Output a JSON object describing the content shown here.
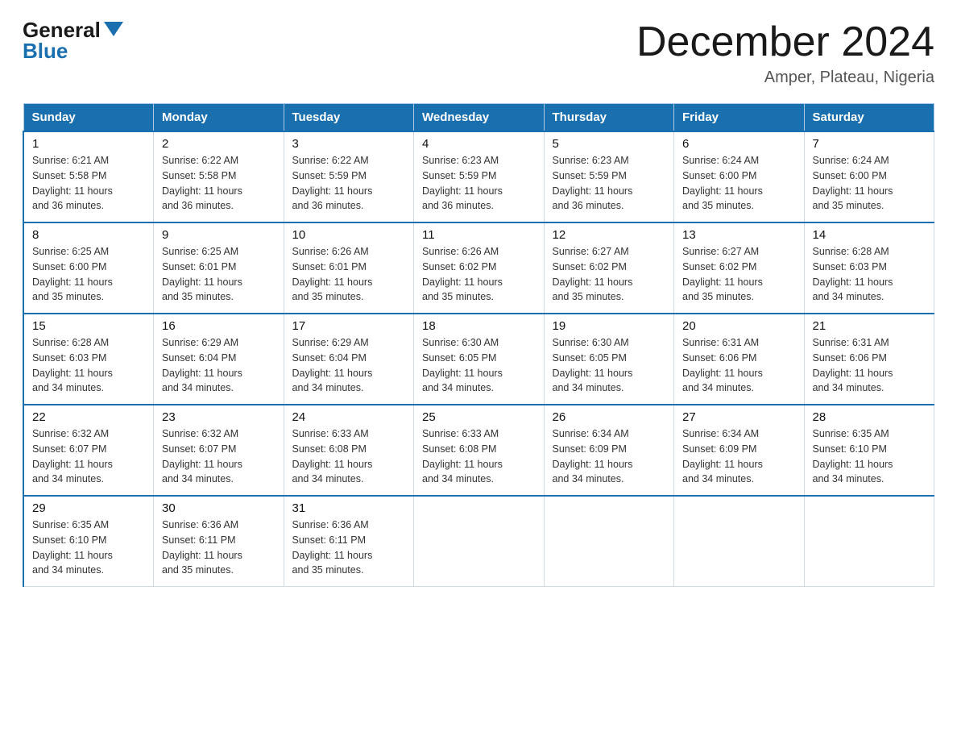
{
  "logo": {
    "general": "General",
    "blue": "Blue"
  },
  "title": "December 2024",
  "location": "Amper, Plateau, Nigeria",
  "days_of_week": [
    "Sunday",
    "Monday",
    "Tuesday",
    "Wednesday",
    "Thursday",
    "Friday",
    "Saturday"
  ],
  "weeks": [
    [
      {
        "day": "1",
        "sunrise": "6:21 AM",
        "sunset": "5:58 PM",
        "daylight": "11 hours and 36 minutes."
      },
      {
        "day": "2",
        "sunrise": "6:22 AM",
        "sunset": "5:58 PM",
        "daylight": "11 hours and 36 minutes."
      },
      {
        "day": "3",
        "sunrise": "6:22 AM",
        "sunset": "5:59 PM",
        "daylight": "11 hours and 36 minutes."
      },
      {
        "day": "4",
        "sunrise": "6:23 AM",
        "sunset": "5:59 PM",
        "daylight": "11 hours and 36 minutes."
      },
      {
        "day": "5",
        "sunrise": "6:23 AM",
        "sunset": "5:59 PM",
        "daylight": "11 hours and 36 minutes."
      },
      {
        "day": "6",
        "sunrise": "6:24 AM",
        "sunset": "6:00 PM",
        "daylight": "11 hours and 35 minutes."
      },
      {
        "day": "7",
        "sunrise": "6:24 AM",
        "sunset": "6:00 PM",
        "daylight": "11 hours and 35 minutes."
      }
    ],
    [
      {
        "day": "8",
        "sunrise": "6:25 AM",
        "sunset": "6:00 PM",
        "daylight": "11 hours and 35 minutes."
      },
      {
        "day": "9",
        "sunrise": "6:25 AM",
        "sunset": "6:01 PM",
        "daylight": "11 hours and 35 minutes."
      },
      {
        "day": "10",
        "sunrise": "6:26 AM",
        "sunset": "6:01 PM",
        "daylight": "11 hours and 35 minutes."
      },
      {
        "day": "11",
        "sunrise": "6:26 AM",
        "sunset": "6:02 PM",
        "daylight": "11 hours and 35 minutes."
      },
      {
        "day": "12",
        "sunrise": "6:27 AM",
        "sunset": "6:02 PM",
        "daylight": "11 hours and 35 minutes."
      },
      {
        "day": "13",
        "sunrise": "6:27 AM",
        "sunset": "6:02 PM",
        "daylight": "11 hours and 35 minutes."
      },
      {
        "day": "14",
        "sunrise": "6:28 AM",
        "sunset": "6:03 PM",
        "daylight": "11 hours and 34 minutes."
      }
    ],
    [
      {
        "day": "15",
        "sunrise": "6:28 AM",
        "sunset": "6:03 PM",
        "daylight": "11 hours and 34 minutes."
      },
      {
        "day": "16",
        "sunrise": "6:29 AM",
        "sunset": "6:04 PM",
        "daylight": "11 hours and 34 minutes."
      },
      {
        "day": "17",
        "sunrise": "6:29 AM",
        "sunset": "6:04 PM",
        "daylight": "11 hours and 34 minutes."
      },
      {
        "day": "18",
        "sunrise": "6:30 AM",
        "sunset": "6:05 PM",
        "daylight": "11 hours and 34 minutes."
      },
      {
        "day": "19",
        "sunrise": "6:30 AM",
        "sunset": "6:05 PM",
        "daylight": "11 hours and 34 minutes."
      },
      {
        "day": "20",
        "sunrise": "6:31 AM",
        "sunset": "6:06 PM",
        "daylight": "11 hours and 34 minutes."
      },
      {
        "day": "21",
        "sunrise": "6:31 AM",
        "sunset": "6:06 PM",
        "daylight": "11 hours and 34 minutes."
      }
    ],
    [
      {
        "day": "22",
        "sunrise": "6:32 AM",
        "sunset": "6:07 PM",
        "daylight": "11 hours and 34 minutes."
      },
      {
        "day": "23",
        "sunrise": "6:32 AM",
        "sunset": "6:07 PM",
        "daylight": "11 hours and 34 minutes."
      },
      {
        "day": "24",
        "sunrise": "6:33 AM",
        "sunset": "6:08 PM",
        "daylight": "11 hours and 34 minutes."
      },
      {
        "day": "25",
        "sunrise": "6:33 AM",
        "sunset": "6:08 PM",
        "daylight": "11 hours and 34 minutes."
      },
      {
        "day": "26",
        "sunrise": "6:34 AM",
        "sunset": "6:09 PM",
        "daylight": "11 hours and 34 minutes."
      },
      {
        "day": "27",
        "sunrise": "6:34 AM",
        "sunset": "6:09 PM",
        "daylight": "11 hours and 34 minutes."
      },
      {
        "day": "28",
        "sunrise": "6:35 AM",
        "sunset": "6:10 PM",
        "daylight": "11 hours and 34 minutes."
      }
    ],
    [
      {
        "day": "29",
        "sunrise": "6:35 AM",
        "sunset": "6:10 PM",
        "daylight": "11 hours and 34 minutes."
      },
      {
        "day": "30",
        "sunrise": "6:36 AM",
        "sunset": "6:11 PM",
        "daylight": "11 hours and 35 minutes."
      },
      {
        "day": "31",
        "sunrise": "6:36 AM",
        "sunset": "6:11 PM",
        "daylight": "11 hours and 35 minutes."
      },
      null,
      null,
      null,
      null
    ]
  ],
  "labels": {
    "sunrise": "Sunrise:",
    "sunset": "Sunset:",
    "daylight": "Daylight:"
  }
}
